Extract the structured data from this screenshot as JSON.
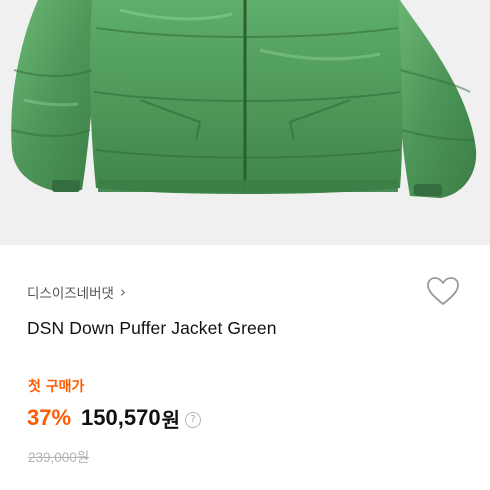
{
  "product": {
    "brand": "디스이즈네버댓",
    "brand_chevron": "›",
    "title": "DSN Down Puffer Jacket Green",
    "first_purchase_label": "첫 구매가",
    "discount": "37%",
    "price": "150,570",
    "currency": "원",
    "help_symbol": "?",
    "original_price": "239,000원"
  },
  "icons": {
    "wishlist": "heart-outline-icon",
    "help": "question-circle-icon"
  },
  "colors": {
    "accent": "#ff5a00",
    "jacket": "#4f9a5b",
    "photo_background": "#f0f0f1",
    "strikethrough": "#b3b3b3"
  }
}
